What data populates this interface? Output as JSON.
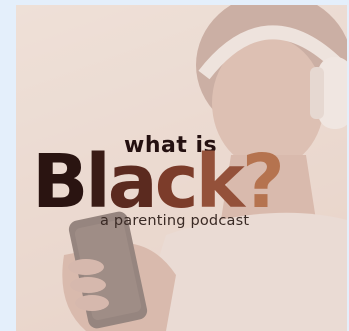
{
  "cover": {
    "line_small": "what is",
    "big_letters": [
      {
        "ch": "B",
        "color": "#2a1411"
      },
      {
        "ch": "l",
        "color": "#3a1c16"
      },
      {
        "ch": "a",
        "color": "#5b2a1f"
      },
      {
        "ch": "c",
        "color": "#7c3c2a"
      },
      {
        "ch": "k",
        "color": "#94513a"
      },
      {
        "ch": "?",
        "color": "#b5734f"
      }
    ],
    "tagline": "a parenting podcast"
  },
  "colors": {
    "page_background": "#e4effb",
    "cover_background": "#ebd6cc"
  },
  "icons": [
    "headphones-illustration",
    "smartphone-illustration"
  ]
}
